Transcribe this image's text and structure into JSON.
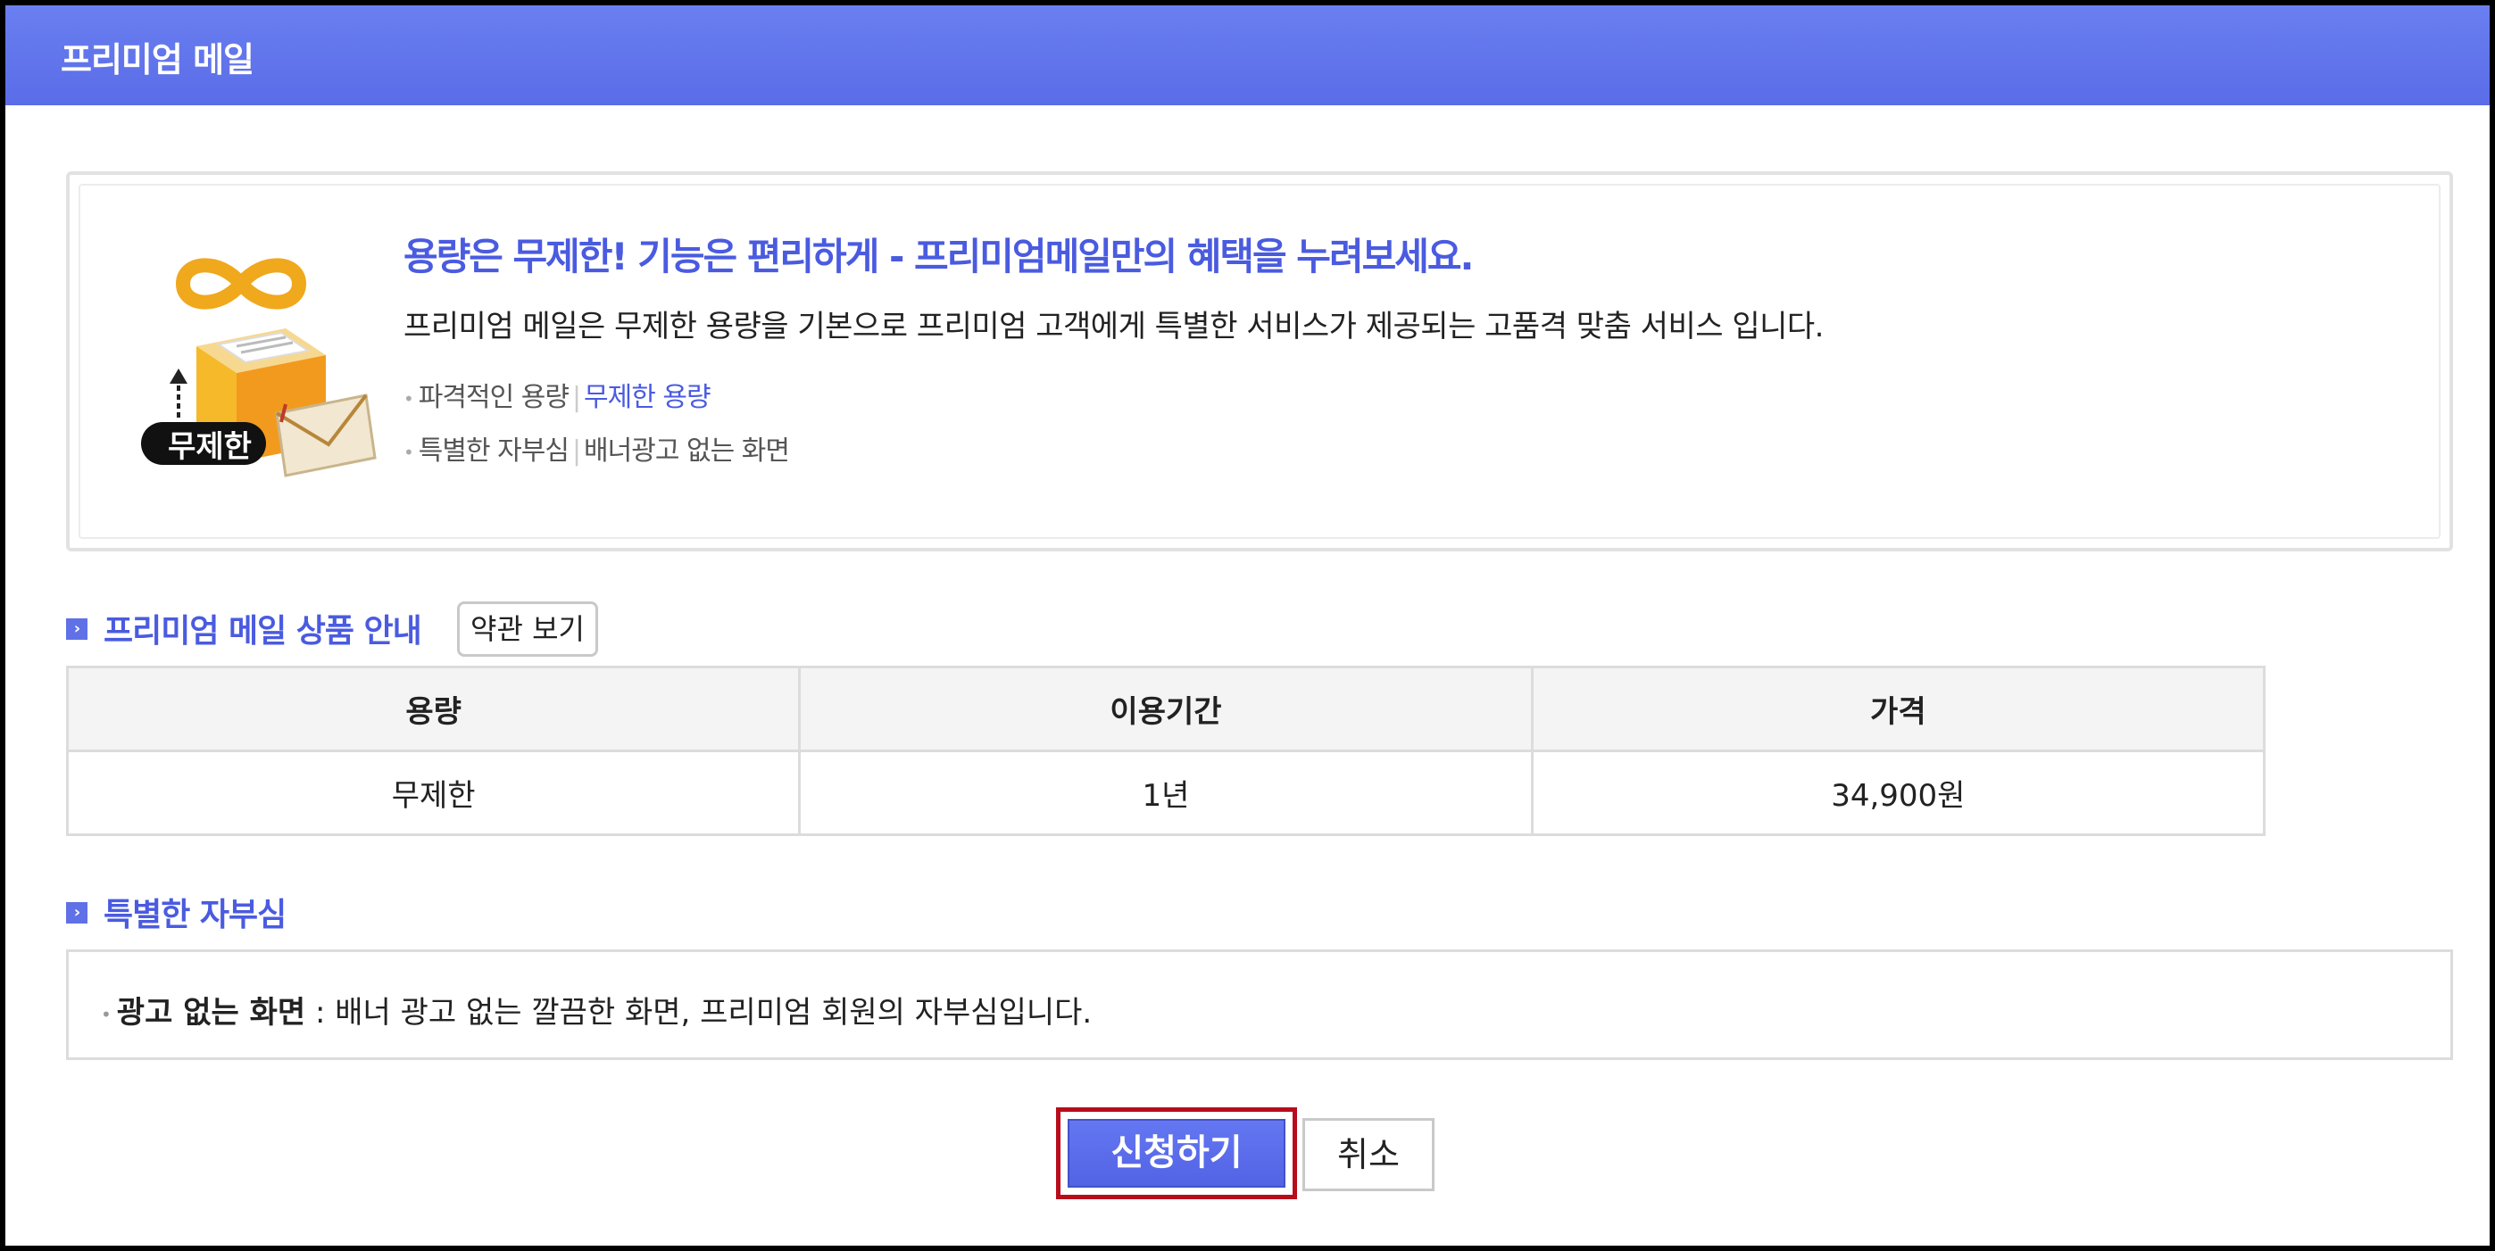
{
  "window": {
    "title": "프리미엄 메일"
  },
  "promo": {
    "badge_text": "무제한",
    "headline": "용량은 무제한! 기능은 편리하게 - 프리미엄메일만의 혜택을 누려보세요.",
    "description": "프리미엄 메일은 무제한 용량을 기본으로 프리미엄 고객에게 특별한 서비스가 제공되는 고품격 맞춤 서비스 입니다.",
    "points": [
      {
        "label": "파격적인 용량",
        "value": "무제한 용량"
      },
      {
        "label": "특별한 자부심",
        "value": "배너광고 없는 화면"
      }
    ]
  },
  "product_section": {
    "title": "프리미엄 메일 상품 안내",
    "terms_button": "약관 보기",
    "columns": [
      "용량",
      "이용기간",
      "가격"
    ],
    "rows": [
      [
        "무제한",
        "1년",
        "34,900원"
      ]
    ]
  },
  "pride_section": {
    "title": "특별한 자부심",
    "item_bold": "광고 없는 화면",
    "item_text": " : 배너 광고 없는 깔끔한 화면, 프리미엄 회원의 자부심입니다."
  },
  "actions": {
    "apply": "신청하기",
    "cancel": "취소"
  },
  "colors": {
    "accent": "#4a5be0",
    "title_bar": "#5a6ce8",
    "apply_outline": "#b80c1c"
  }
}
